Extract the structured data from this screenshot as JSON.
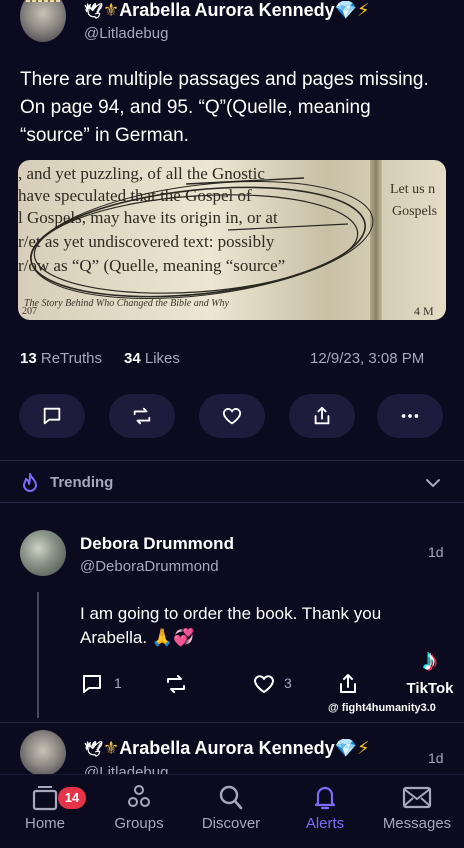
{
  "post": {
    "author_name": "Arabella Aurora Kennedy",
    "author_handle": "@Litladebug",
    "text": "There are multiple passages and pages missing. On page 94, and 95. “Q”(Quelle, meaning “source” in German.",
    "image_text": {
      "lines": [
        ", and yet puzzling, of all the Gnostic",
        "have speculated that the Gospel of",
        "l Gospels, may have its origin in, or at",
        "r/et as yet undiscovered text: possibly",
        "r/ow as “Q” (Quelle, meaning “source”"
      ],
      "right_lines": [
        "Let us n",
        "Gospels"
      ],
      "footer": "The Story Behind Who Changed the Bible and Why",
      "page_left": "207",
      "page_right": "4   M"
    },
    "retruths_count": "13",
    "retruths_label": "ReTruths",
    "likes_count": "34",
    "likes_label": "Likes",
    "timestamp": "12/9/23, 3:08 PM",
    "actions": [
      "reply",
      "retruth",
      "like",
      "share",
      "more"
    ]
  },
  "trending": {
    "label": "Trending"
  },
  "reply": {
    "author_name": "Debora Drummond",
    "author_handle": "@DeboraDrummond",
    "time": "1d",
    "text": "I am going to order the book. Thank you Arabella. 🙏💞",
    "reply_count": "1",
    "like_count": "3"
  },
  "next_post": {
    "author_name": "Arabella Aurora Kennedy",
    "author_handle": "@Litladebug",
    "time": "1d"
  },
  "watermark": {
    "brand": "TikTok",
    "user": "@ fight4humanity3.0"
  },
  "nav": {
    "items": [
      {
        "label": "Home",
        "icon": "home-icon"
      },
      {
        "label": "Groups",
        "icon": "groups-icon"
      },
      {
        "label": "Discover",
        "icon": "search-icon"
      },
      {
        "label": "Alerts",
        "icon": "bell-icon"
      },
      {
        "label": "Messages",
        "icon": "mail-icon"
      }
    ],
    "home_badge": "14",
    "active": "Alerts"
  },
  "colors": {
    "background": "#0c0a1e",
    "accent": "#7b6cf6",
    "muted": "#a9a6bf",
    "button_bg": "#1f1b3c",
    "badge": "#e5344a",
    "verified": "#4fb6f0",
    "bolt": "#f5c518"
  }
}
